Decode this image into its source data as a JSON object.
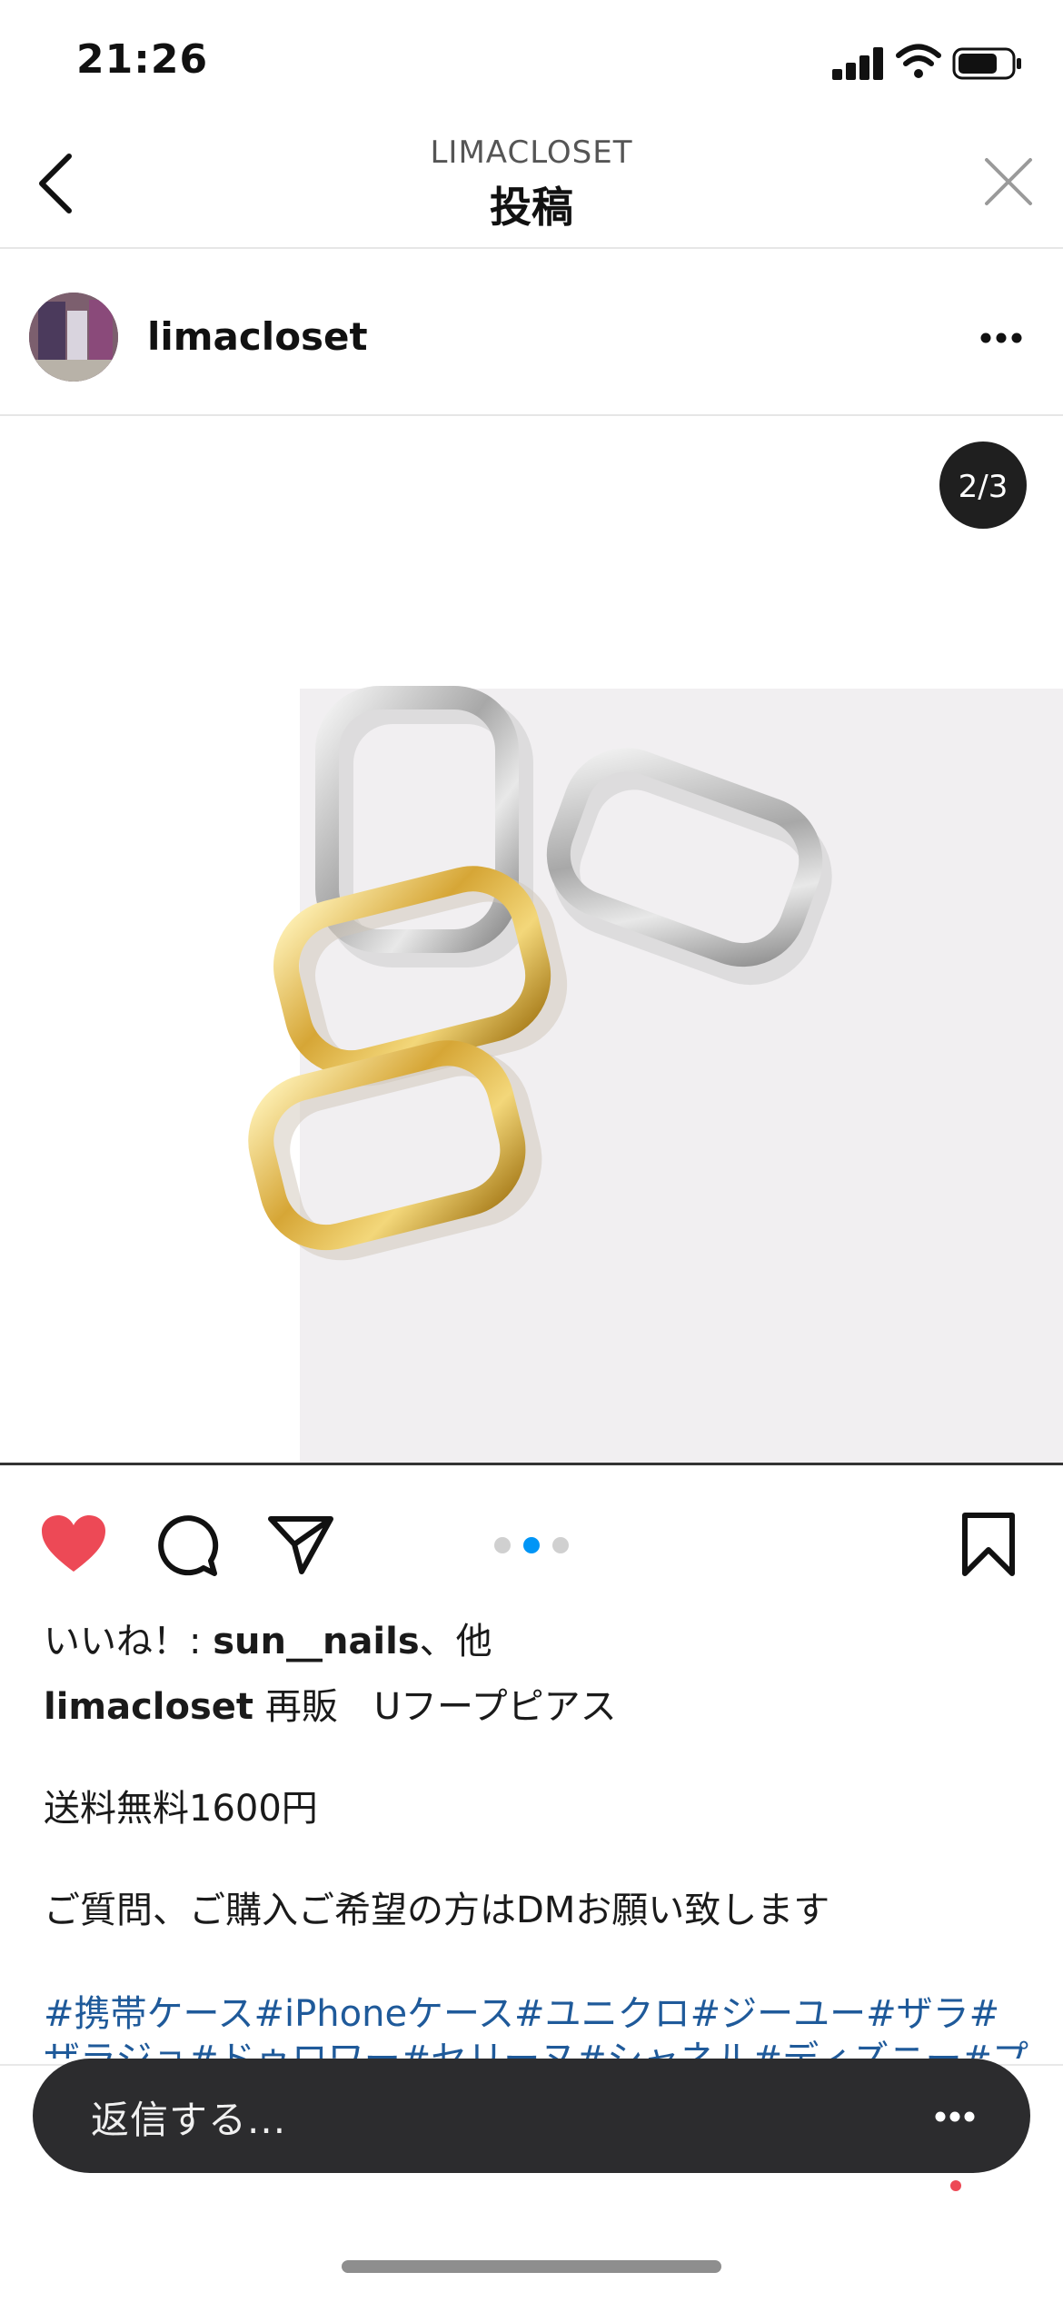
{
  "status_bar": {
    "time": "21:26"
  },
  "header": {
    "account": "LIMACLOSET",
    "title": "投稿"
  },
  "post": {
    "username": "limacloset",
    "image_counter": "2/3",
    "carousel": {
      "count": 3,
      "active_index": 1
    }
  },
  "likes": {
    "prefix": "いいね！: ",
    "user": "sun__nails",
    "suffix": "、他"
  },
  "caption": {
    "user": "limacloset",
    "title": " 再販　Uフープピアス",
    "line2": "送料無料1600円",
    "line3": "ご質問、ご購入ご希望の方はDMお願い致します",
    "hashtags_line1": "#携帯ケース#iPhoneケース#ユニクロ#ジーユー#ザラ#",
    "hashtags_line2": "ザラジョ#ドゥロワー#セリーヌ#シャネル#ディズニー#プ"
  },
  "reply_bar": {
    "placeholder": "返信する..."
  },
  "colors": {
    "like": "#ed4956",
    "hashtag": "#1f5a9a",
    "active_dot": "#0095f6",
    "reply_bg": "#2c2c2e"
  },
  "icons": [
    "back-icon",
    "close-icon",
    "more-icon",
    "heart-icon",
    "comment-icon",
    "share-icon",
    "bookmark-icon",
    "home-icon",
    "search-icon",
    "reels-icon",
    "shop-icon"
  ]
}
